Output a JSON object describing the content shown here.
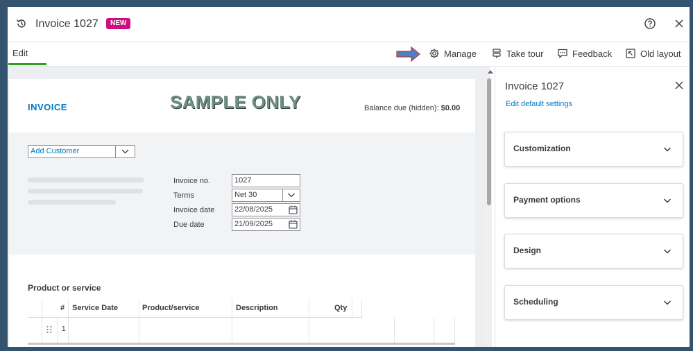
{
  "window": {
    "title": "Invoice 1027",
    "badge": "NEW"
  },
  "toolbar": {
    "edit_tab": "Edit",
    "manage": "Manage",
    "take_tour": "Take tour",
    "feedback": "Feedback",
    "old_layout": "Old layout"
  },
  "invoice": {
    "heading": "INVOICE",
    "watermark": "SAMPLE ONLY",
    "balance_label": "Balance due (hidden):",
    "balance_value": "$0.00",
    "customer_placeholder": "Add Customer",
    "fields": {
      "invoice_no_label": "Invoice no.",
      "invoice_no_value": "1027",
      "terms_label": "Terms",
      "terms_value": "Net 30",
      "invoice_date_label": "Invoice date",
      "invoice_date_value": "22/08/2025",
      "due_date_label": "Due date",
      "due_date_value": "21/09/2025"
    },
    "section_title": "Product or service",
    "table": {
      "columns": [
        "#",
        "Service Date",
        "Product/service",
        "Description",
        "Qty"
      ],
      "rows": [
        {
          "num": "1"
        }
      ]
    }
  },
  "panel": {
    "title": "Invoice 1027",
    "link": "Edit default settings",
    "sections": [
      "Customization",
      "Payment options",
      "Design",
      "Scheduling"
    ]
  },
  "colors": {
    "accent_blue": "#0077c5",
    "badge_magenta": "#cd0e81",
    "tab_green": "#2ca01c",
    "frame": "#34536f"
  }
}
